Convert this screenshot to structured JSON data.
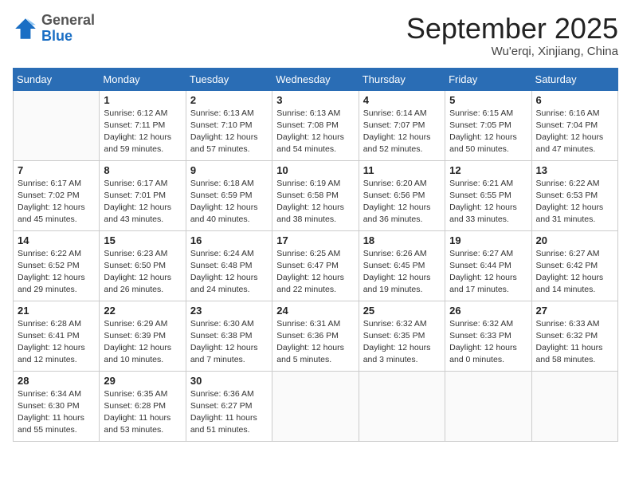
{
  "header": {
    "logo_general": "General",
    "logo_blue": "Blue",
    "month_title": "September 2025",
    "location": "Wu'erqi, Xinjiang, China"
  },
  "days_of_week": [
    "Sunday",
    "Monday",
    "Tuesday",
    "Wednesday",
    "Thursday",
    "Friday",
    "Saturday"
  ],
  "weeks": [
    [
      {
        "day": "",
        "info": ""
      },
      {
        "day": "1",
        "info": "Sunrise: 6:12 AM\nSunset: 7:11 PM\nDaylight: 12 hours\nand 59 minutes."
      },
      {
        "day": "2",
        "info": "Sunrise: 6:13 AM\nSunset: 7:10 PM\nDaylight: 12 hours\nand 57 minutes."
      },
      {
        "day": "3",
        "info": "Sunrise: 6:13 AM\nSunset: 7:08 PM\nDaylight: 12 hours\nand 54 minutes."
      },
      {
        "day": "4",
        "info": "Sunrise: 6:14 AM\nSunset: 7:07 PM\nDaylight: 12 hours\nand 52 minutes."
      },
      {
        "day": "5",
        "info": "Sunrise: 6:15 AM\nSunset: 7:05 PM\nDaylight: 12 hours\nand 50 minutes."
      },
      {
        "day": "6",
        "info": "Sunrise: 6:16 AM\nSunset: 7:04 PM\nDaylight: 12 hours\nand 47 minutes."
      }
    ],
    [
      {
        "day": "7",
        "info": "Sunrise: 6:17 AM\nSunset: 7:02 PM\nDaylight: 12 hours\nand 45 minutes."
      },
      {
        "day": "8",
        "info": "Sunrise: 6:17 AM\nSunset: 7:01 PM\nDaylight: 12 hours\nand 43 minutes."
      },
      {
        "day": "9",
        "info": "Sunrise: 6:18 AM\nSunset: 6:59 PM\nDaylight: 12 hours\nand 40 minutes."
      },
      {
        "day": "10",
        "info": "Sunrise: 6:19 AM\nSunset: 6:58 PM\nDaylight: 12 hours\nand 38 minutes."
      },
      {
        "day": "11",
        "info": "Sunrise: 6:20 AM\nSunset: 6:56 PM\nDaylight: 12 hours\nand 36 minutes."
      },
      {
        "day": "12",
        "info": "Sunrise: 6:21 AM\nSunset: 6:55 PM\nDaylight: 12 hours\nand 33 minutes."
      },
      {
        "day": "13",
        "info": "Sunrise: 6:22 AM\nSunset: 6:53 PM\nDaylight: 12 hours\nand 31 minutes."
      }
    ],
    [
      {
        "day": "14",
        "info": "Sunrise: 6:22 AM\nSunset: 6:52 PM\nDaylight: 12 hours\nand 29 minutes."
      },
      {
        "day": "15",
        "info": "Sunrise: 6:23 AM\nSunset: 6:50 PM\nDaylight: 12 hours\nand 26 minutes."
      },
      {
        "day": "16",
        "info": "Sunrise: 6:24 AM\nSunset: 6:48 PM\nDaylight: 12 hours\nand 24 minutes."
      },
      {
        "day": "17",
        "info": "Sunrise: 6:25 AM\nSunset: 6:47 PM\nDaylight: 12 hours\nand 22 minutes."
      },
      {
        "day": "18",
        "info": "Sunrise: 6:26 AM\nSunset: 6:45 PM\nDaylight: 12 hours\nand 19 minutes."
      },
      {
        "day": "19",
        "info": "Sunrise: 6:27 AM\nSunset: 6:44 PM\nDaylight: 12 hours\nand 17 minutes."
      },
      {
        "day": "20",
        "info": "Sunrise: 6:27 AM\nSunset: 6:42 PM\nDaylight: 12 hours\nand 14 minutes."
      }
    ],
    [
      {
        "day": "21",
        "info": "Sunrise: 6:28 AM\nSunset: 6:41 PM\nDaylight: 12 hours\nand 12 minutes."
      },
      {
        "day": "22",
        "info": "Sunrise: 6:29 AM\nSunset: 6:39 PM\nDaylight: 12 hours\nand 10 minutes."
      },
      {
        "day": "23",
        "info": "Sunrise: 6:30 AM\nSunset: 6:38 PM\nDaylight: 12 hours\nand 7 minutes."
      },
      {
        "day": "24",
        "info": "Sunrise: 6:31 AM\nSunset: 6:36 PM\nDaylight: 12 hours\nand 5 minutes."
      },
      {
        "day": "25",
        "info": "Sunrise: 6:32 AM\nSunset: 6:35 PM\nDaylight: 12 hours\nand 3 minutes."
      },
      {
        "day": "26",
        "info": "Sunrise: 6:32 AM\nSunset: 6:33 PM\nDaylight: 12 hours\nand 0 minutes."
      },
      {
        "day": "27",
        "info": "Sunrise: 6:33 AM\nSunset: 6:32 PM\nDaylight: 11 hours\nand 58 minutes."
      }
    ],
    [
      {
        "day": "28",
        "info": "Sunrise: 6:34 AM\nSunset: 6:30 PM\nDaylight: 11 hours\nand 55 minutes."
      },
      {
        "day": "29",
        "info": "Sunrise: 6:35 AM\nSunset: 6:28 PM\nDaylight: 11 hours\nand 53 minutes."
      },
      {
        "day": "30",
        "info": "Sunrise: 6:36 AM\nSunset: 6:27 PM\nDaylight: 11 hours\nand 51 minutes."
      },
      {
        "day": "",
        "info": ""
      },
      {
        "day": "",
        "info": ""
      },
      {
        "day": "",
        "info": ""
      },
      {
        "day": "",
        "info": ""
      }
    ]
  ]
}
